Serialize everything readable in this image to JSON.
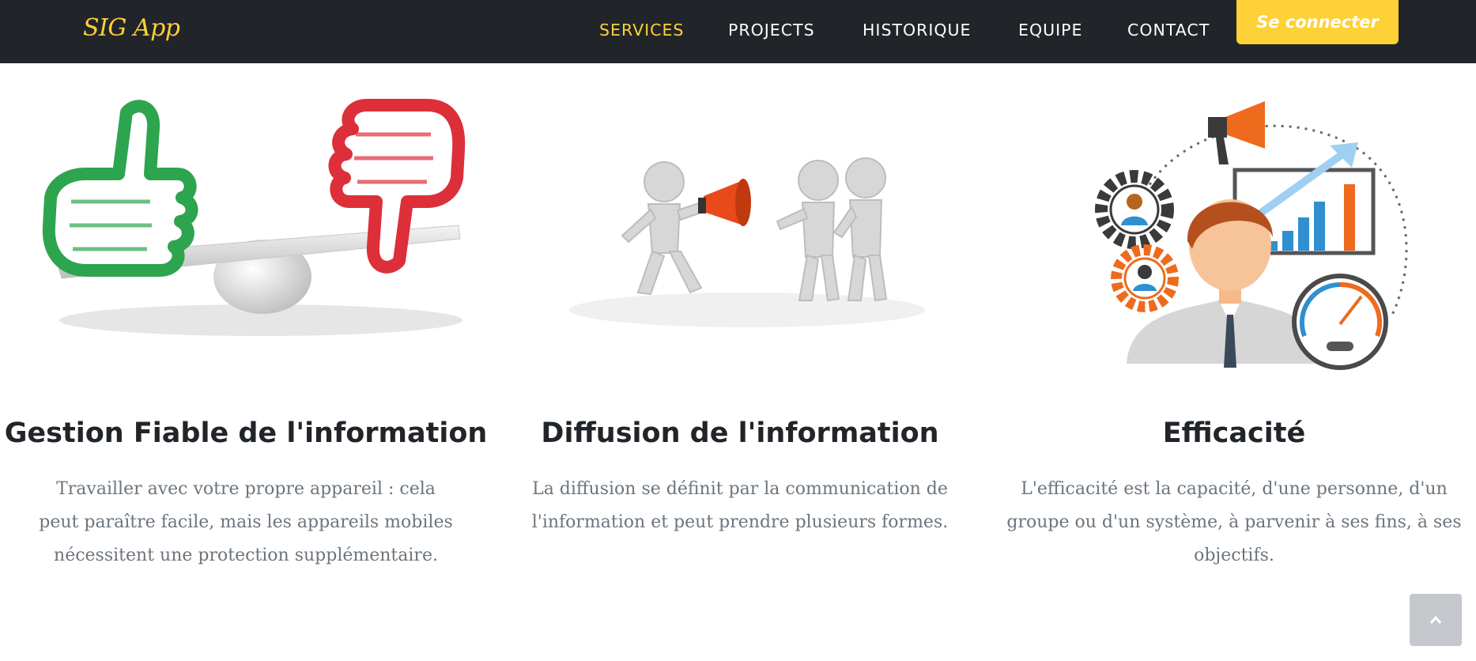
{
  "navbar": {
    "brand": "SIG App",
    "links": [
      "SERVICES",
      "PROJECTS",
      "HISTORIQUE",
      "EQUIPE",
      "CONTACT"
    ],
    "active_link": "SERVICES",
    "login_label": "Se connecter",
    "background": "#212529",
    "accent": "#fed136"
  },
  "services": [
    {
      "title": "Gestion Fiable de l'information",
      "text": "Travailler avec votre propre appareil : cela peut paraître facile, mais les appareils mobiles nécessitent une protection supplémentaire.",
      "image": "thumbs-balance-icon"
    },
    {
      "title": "Diffusion de l'information",
      "text": "La diffusion se définit par la communication de l'information et peut prendre plusieurs formes.",
      "image": "megaphone-people-icon"
    },
    {
      "title": "Efficacité",
      "text": "L'efficacité est la capacité, d'une personne, d'un groupe ou d'un système, à parvenir à ses fins, à ses objectifs.",
      "image": "efficiency-dashboard-icon"
    }
  ],
  "scroll_top": {
    "icon": "chevron-up-icon"
  }
}
